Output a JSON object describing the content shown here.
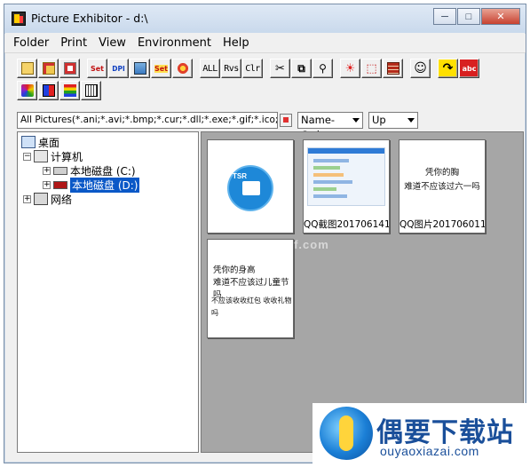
{
  "window": {
    "title": "Picture Exhibitor - d:\\",
    "controls": {
      "minimize": "─",
      "maximize": "□",
      "close": "✕"
    }
  },
  "menu": [
    "Folder",
    "Print",
    "View",
    "Environment",
    "Help"
  ],
  "toolbar": {
    "row1": [
      {
        "name": "new-folder-icon",
        "label": ""
      },
      {
        "name": "open-folder-icon",
        "label": ""
      },
      {
        "name": "delete-folder-icon",
        "label": ""
      },
      {
        "name": "set-icon",
        "label": "Set"
      },
      {
        "name": "dpi-icon",
        "label": "DPI"
      },
      {
        "name": "stack-icon",
        "label": ""
      },
      {
        "name": "set-color-icon",
        "label": "Set"
      },
      {
        "name": "flower-icon",
        "label": ""
      },
      {
        "name": "all-button",
        "label": "ALL"
      },
      {
        "name": "rvs-button",
        "label": "Rvs"
      },
      {
        "name": "clr-button",
        "label": "Clr"
      },
      {
        "name": "cut-icon",
        "label": "✂"
      },
      {
        "name": "copy-icon",
        "label": "⧉"
      },
      {
        "name": "pin-icon",
        "label": "⚲"
      },
      {
        "name": "sun-icon",
        "label": "☀"
      },
      {
        "name": "select-icon",
        "label": "⬚"
      },
      {
        "name": "brick-icon",
        "label": ""
      },
      {
        "name": "face-icon",
        "label": "☺"
      },
      {
        "name": "rotate-icon",
        "label": "↷"
      },
      {
        "name": "abc-icon",
        "label": "abc"
      }
    ],
    "row2": [
      {
        "name": "palette-icon",
        "label": ""
      },
      {
        "name": "tiles-icon",
        "label": ""
      },
      {
        "name": "color-bars-icon",
        "label": ""
      },
      {
        "name": "keyboard-icon",
        "label": ""
      }
    ]
  },
  "filter": {
    "value": "All Pictures(*.ani;*.avi;*.bmp;*.cur;*.dll;*.exe;*.gif;*.ico;*.jpe;",
    "sort_field": "Name-Order",
    "sort_direction": "Up"
  },
  "tree": {
    "desktop": "桌面",
    "computer": "计算机",
    "drive_c": "本地磁盘 (C:)",
    "drive_d": "本地磁盘 (D:)",
    "network": "网络"
  },
  "thumbnails": [
    {
      "caption": "",
      "kind": "tsr-logo",
      "logo_text": "TSR"
    },
    {
      "caption": "QQ截图201706141",
      "kind": "screenshot"
    },
    {
      "caption": "QQ图片201706011",
      "kind": "text",
      "lines": [
        "凭你的胸",
        "难道不应该过六一吗"
      ]
    },
    {
      "caption": "",
      "kind": "text",
      "lines": [
        "凭你的身高",
        "难道不应该过儿童节吗",
        "",
        "不应该收收红包 收收礼物吗"
      ]
    }
  ],
  "watermark": "www.greenxf.com",
  "brand": {
    "title": "偶要下载站",
    "url": "ouyaoxiazai.com"
  },
  "colors": {
    "selection": "#0a58c7",
    "thumb_area": "#a6a6a6",
    "brand": "#1a4f9a"
  }
}
